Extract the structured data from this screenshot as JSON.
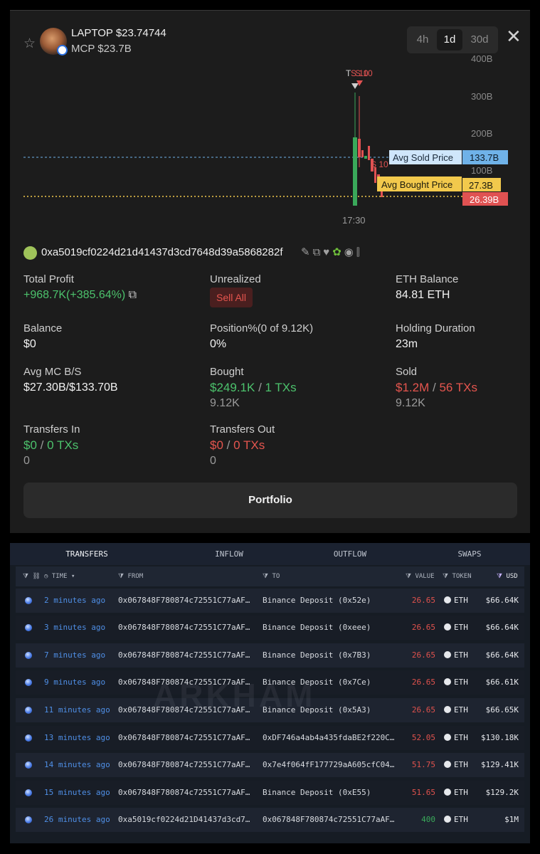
{
  "token": {
    "name": "LAPTOP $23.74744",
    "mcp": "MCP $23.7B"
  },
  "timeframes": [
    "4h",
    "1d",
    "30d"
  ],
  "active_timeframe": "1d",
  "chart": {
    "y_labels": [
      "400B",
      "300B",
      "200B",
      "100B"
    ],
    "x_label": "17:30",
    "markers": [
      "T",
      "S 10",
      "S 10",
      "S 10"
    ],
    "avg_sold": {
      "label": "Avg Sold Price",
      "value": "133.7B"
    },
    "avg_bought": {
      "label": "Avg Bought Price",
      "value": "27.3B"
    },
    "current": "26.39B",
    "colors": {
      "sold": "#6fb2e8",
      "bought": "#f2c94c",
      "current": "#e05252"
    }
  },
  "wallet": {
    "address": "0xa5019cf0224d21d41437d3cd7648d39a5868282f"
  },
  "stats": {
    "total_profit_label": "Total Profit",
    "total_profit_value": "+968.7K(+385.64%)",
    "unrealized_label": "Unrealized",
    "sell_all": "Sell All",
    "eth_balance_label": "ETH Balance",
    "eth_balance_value": "84.81 ETH",
    "balance_label": "Balance",
    "balance_value": "$0",
    "position_label": "Position%(0 of 9.12K)",
    "position_value": "0%",
    "holding_label": "Holding Duration",
    "holding_value": "23m",
    "avg_mc_label": "Avg MC B/S",
    "avg_mc_value": "$27.30B/$133.70B",
    "bought_label": "Bought",
    "bought_usd": "$249.1K",
    "bought_sep": "/",
    "bought_txs": "1 TXs",
    "bought_amount": "9.12K",
    "sold_label": "Sold",
    "sold_usd": "$1.2M",
    "sold_sep": "/",
    "sold_txs": "56 TXs",
    "sold_amount": "9.12K",
    "transfers_in_label": "Transfers In",
    "transfers_in_usd": "$0",
    "transfers_in_sep": "/",
    "transfers_in_txs": "0 TXs",
    "transfers_in_amount": "0",
    "transfers_out_label": "Transfers Out",
    "transfers_out_usd": "$0",
    "transfers_out_sep": "/",
    "transfers_out_txs": "0 TXs",
    "transfers_out_amount": "0"
  },
  "portfolio_button": "Portfolio",
  "transfers": {
    "tabs": [
      "TRANSFERS",
      "INFLOW",
      "OUTFLOW",
      "SWAPS"
    ],
    "headers": {
      "time": "TIME",
      "from": "FROM",
      "to": "TO",
      "value": "VALUE",
      "token": "TOKEN",
      "usd": "USD"
    },
    "rows": [
      {
        "time": "2 minutes ago",
        "from": "0x067848F780874c72551C77aAF…",
        "to": "Binance Deposit (0x52e)",
        "value": "26.65",
        "token": "ETH",
        "usd": "$66.64K"
      },
      {
        "time": "3 minutes ago",
        "from": "0x067848F780874c72551C77aAF…",
        "to": "Binance Deposit (0xeee)",
        "value": "26.65",
        "token": "ETH",
        "usd": "$66.64K"
      },
      {
        "time": "7 minutes ago",
        "from": "0x067848F780874c72551C77aAF…",
        "to": "Binance Deposit (0x7B3)",
        "value": "26.65",
        "token": "ETH",
        "usd": "$66.64K"
      },
      {
        "time": "9 minutes ago",
        "from": "0x067848F780874c72551C77aAF…",
        "to": "Binance Deposit (0x7Ce)",
        "value": "26.65",
        "token": "ETH",
        "usd": "$66.61K"
      },
      {
        "time": "11 minutes ago",
        "from": "0x067848F780874c72551C77aAF…",
        "to": "Binance Deposit (0x5A3)",
        "value": "26.65",
        "token": "ETH",
        "usd": "$66.65K"
      },
      {
        "time": "13 minutes ago",
        "from": "0x067848F780874c72551C77aAF…",
        "to": "0xDF746a4ab4a435fdaBE2f220C…",
        "value": "52.05",
        "token": "ETH",
        "usd": "$130.18K"
      },
      {
        "time": "14 minutes ago",
        "from": "0x067848F780874c72551C77aAF…",
        "to": "0x7e4f064fF177729aA605cfC04…",
        "value": "51.75",
        "token": "ETH",
        "usd": "$129.41K"
      },
      {
        "time": "15 minutes ago",
        "from": "0x067848F780874c72551C77aAF…",
        "to": "Binance Deposit (0xE55)",
        "value": "51.65",
        "token": "ETH",
        "usd": "$129.2K"
      },
      {
        "time": "26 minutes ago",
        "from": "0xa5019cf0224d21D41437d3cd7…",
        "to": "0x067848F780874c72551C77aAF…",
        "value": "400",
        "token": "ETH",
        "usd": "$1M"
      }
    ]
  },
  "watermark": "ARKHAM"
}
